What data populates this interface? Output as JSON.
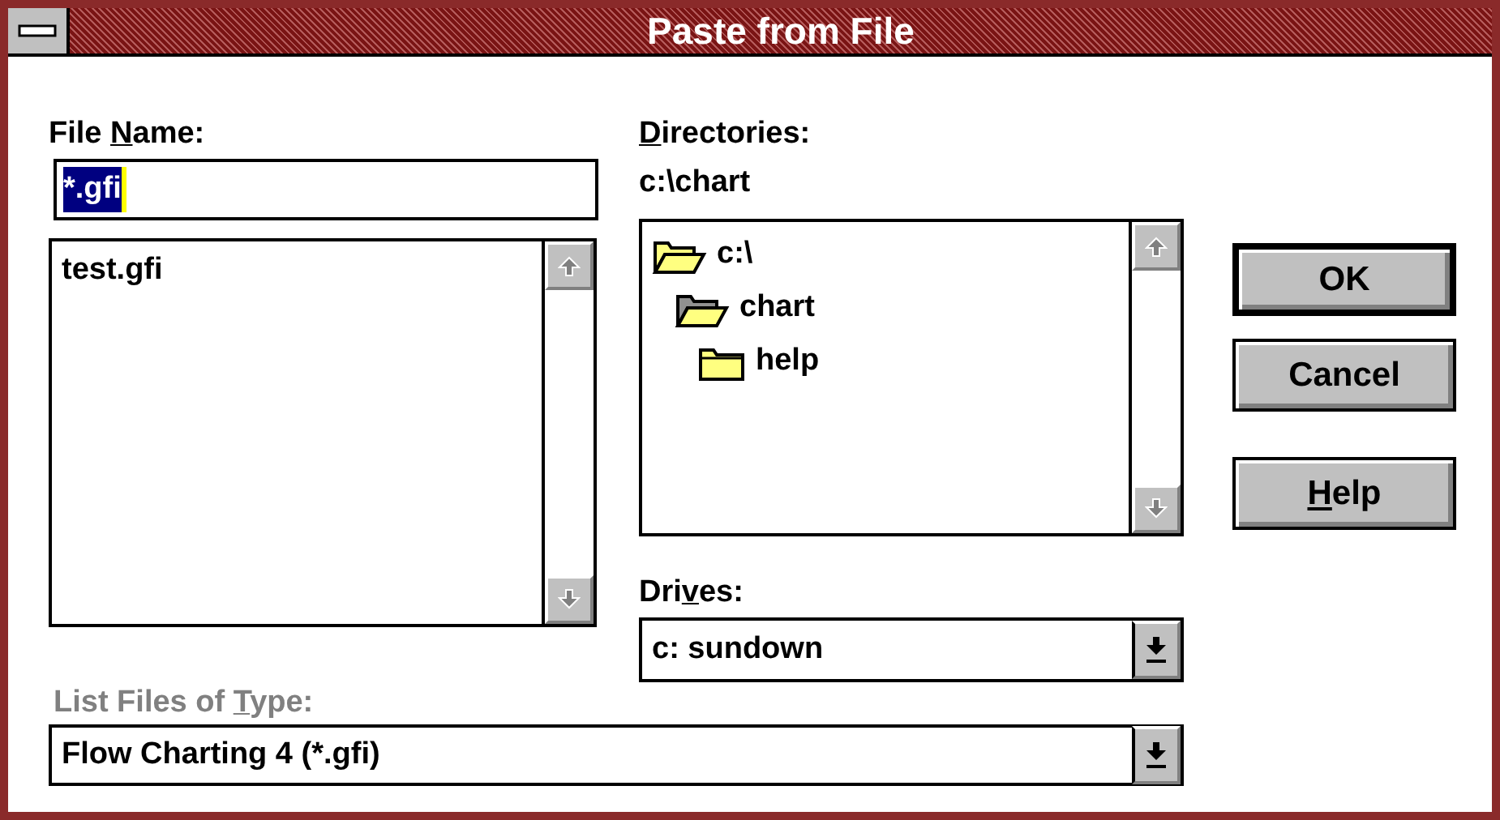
{
  "window": {
    "title": "Paste from File"
  },
  "file_name": {
    "label": {
      "before": "File ",
      "key": "N",
      "after": "ame:"
    },
    "value": "*.gfi",
    "value_selected": true
  },
  "files": [
    {
      "name": "test.gfi",
      "selected": false
    }
  ],
  "directories": {
    "label": {
      "key": "D",
      "after": "irectories:"
    },
    "path": "c:\\chart",
    "tree": [
      {
        "name": "c:\\",
        "open": true,
        "current": false,
        "children": [
          {
            "name": "chart",
            "open": true,
            "current": true,
            "children": [
              {
                "name": "help",
                "open": false,
                "current": false
              }
            ]
          }
        ]
      }
    ]
  },
  "drives": {
    "label": {
      "before": "Dri",
      "key": "v",
      "after": "es:"
    },
    "value": "c: sundown"
  },
  "file_type": {
    "label": {
      "before": "List Files of ",
      "key": "T",
      "after": "ype:"
    },
    "disabled": true,
    "value": "Flow Charting 4 (*.gfi)"
  },
  "buttons": [
    {
      "label": {
        "before": "OK"
      },
      "default": true
    },
    {
      "label": {
        "before": "Cancel"
      },
      "default": false
    },
    {
      "label": {
        "key": "H",
        "after": "elp"
      },
      "default": false
    }
  ]
}
